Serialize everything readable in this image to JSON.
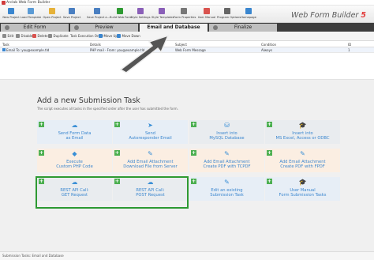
{
  "window": {
    "title": "Arclab Web Form Builder"
  },
  "ribbon": {
    "buttons": [
      {
        "label": "New Project",
        "icon": "new-project-icon",
        "color": "#3a86cf"
      },
      {
        "label": "Load Template",
        "icon": "load-template-icon",
        "color": "#5b9bd5"
      },
      {
        "label": "Open Project",
        "icon": "open-project-icon",
        "color": "#e6b23a"
      },
      {
        "label": "Save Project",
        "icon": "save-project-icon",
        "color": "#4a7fc1"
      },
      {
        "label": "Save Project a...",
        "icon": "save-as-icon",
        "color": "#4a7fc1"
      },
      {
        "label": "Build Web Form",
        "icon": "build-icon",
        "color": "#2e9a32"
      },
      {
        "label": "Style Settings",
        "icon": "style-settings-icon",
        "color": "#8a5fb8"
      },
      {
        "label": "Style Templates",
        "icon": "style-templates-icon",
        "color": "#8a5fb8"
      },
      {
        "label": "Form Properties",
        "icon": "form-properties-icon",
        "color": "#777777"
      },
      {
        "label": "User Manual",
        "icon": "user-manual-icon",
        "color": "#d9534f"
      },
      {
        "label": "Program Options",
        "icon": "program-options-icon",
        "color": "#666666"
      },
      {
        "label": "Homepage",
        "icon": "homepage-icon",
        "color": "#3a86cf"
      }
    ],
    "brand": "Web Form Builder",
    "brand_version": "5"
  },
  "tabs": [
    {
      "label": "Edit Form",
      "active": false
    },
    {
      "label": "Preview",
      "active": false
    },
    {
      "label": "Email and Database",
      "active": true
    },
    {
      "label": "Finalize",
      "active": false
    }
  ],
  "toolbar": {
    "items": [
      "Edit",
      "Disable",
      "Delete",
      "Duplicate",
      "Task Execution Order",
      "Move Up",
      "Move Down"
    ]
  },
  "task_grid": {
    "columns": [
      "Task",
      "Details",
      "Subject",
      "Condition",
      "ID"
    ],
    "rows": [
      {
        "task": "Email To: you@example.tld",
        "details": "PHP mail - From: you@example.tld",
        "subject": "Web Form Message",
        "condition": "Always",
        "id": "1"
      }
    ]
  },
  "submission_panel": {
    "title": "Add a new Submission Task",
    "description": "The script executes all tasks in the specified order after the user has submitted the form.",
    "cards": [
      {
        "line1": "Send Form Data",
        "line2": "as Email",
        "icon": "email-icon",
        "bg": "blue"
      },
      {
        "line1": "Send",
        "line2": "Autoresponder Email",
        "icon": "send-icon",
        "bg": "blue"
      },
      {
        "line1": "Insert into",
        "line2": "MySQL Database",
        "icon": "database-icon",
        "bg": "grey"
      },
      {
        "line1": "Insert into",
        "line2": "MS Excel, Access or ODBC",
        "icon": "graduation-cap-icon",
        "bg": "grey"
      },
      {
        "line1": "Execute",
        "line2": "Custom PHP Code",
        "icon": "code-icon",
        "bg": "peach"
      },
      {
        "line1": "Add Email Attachment",
        "line2": "Download File from Server",
        "icon": "paperclip-icon",
        "bg": "peach"
      },
      {
        "line1": "Add Email Attachment",
        "line2": "Create PDF with TCPDF",
        "icon": "paperclip-icon",
        "bg": "peach"
      },
      {
        "line1": "Add Email Attachment",
        "line2": "Create PDF with FPDF",
        "icon": "paperclip-icon",
        "bg": "peach"
      },
      {
        "line1": "REST API Call:",
        "line2": "GET Request",
        "icon": "cloud-icon",
        "bg": "grey"
      },
      {
        "line1": "REST API Call:",
        "line2": "POST Request",
        "icon": "cloud-icon",
        "bg": "grey"
      },
      {
        "line1": "Edit an existing",
        "line2": "Submission Task",
        "icon": "pencil-icon",
        "bg": "blue"
      },
      {
        "line1": "User Manual",
        "line2": "Form Submission Tasks",
        "icon": "graduation-cap-icon",
        "bg": "blue"
      }
    ]
  },
  "status": {
    "text": "Submission Tasks: Email and Database"
  },
  "colors": {
    "accent_green": "#2e9a32",
    "accent_blue": "#3a86cf",
    "tab_bar": "#3c3c3c"
  }
}
